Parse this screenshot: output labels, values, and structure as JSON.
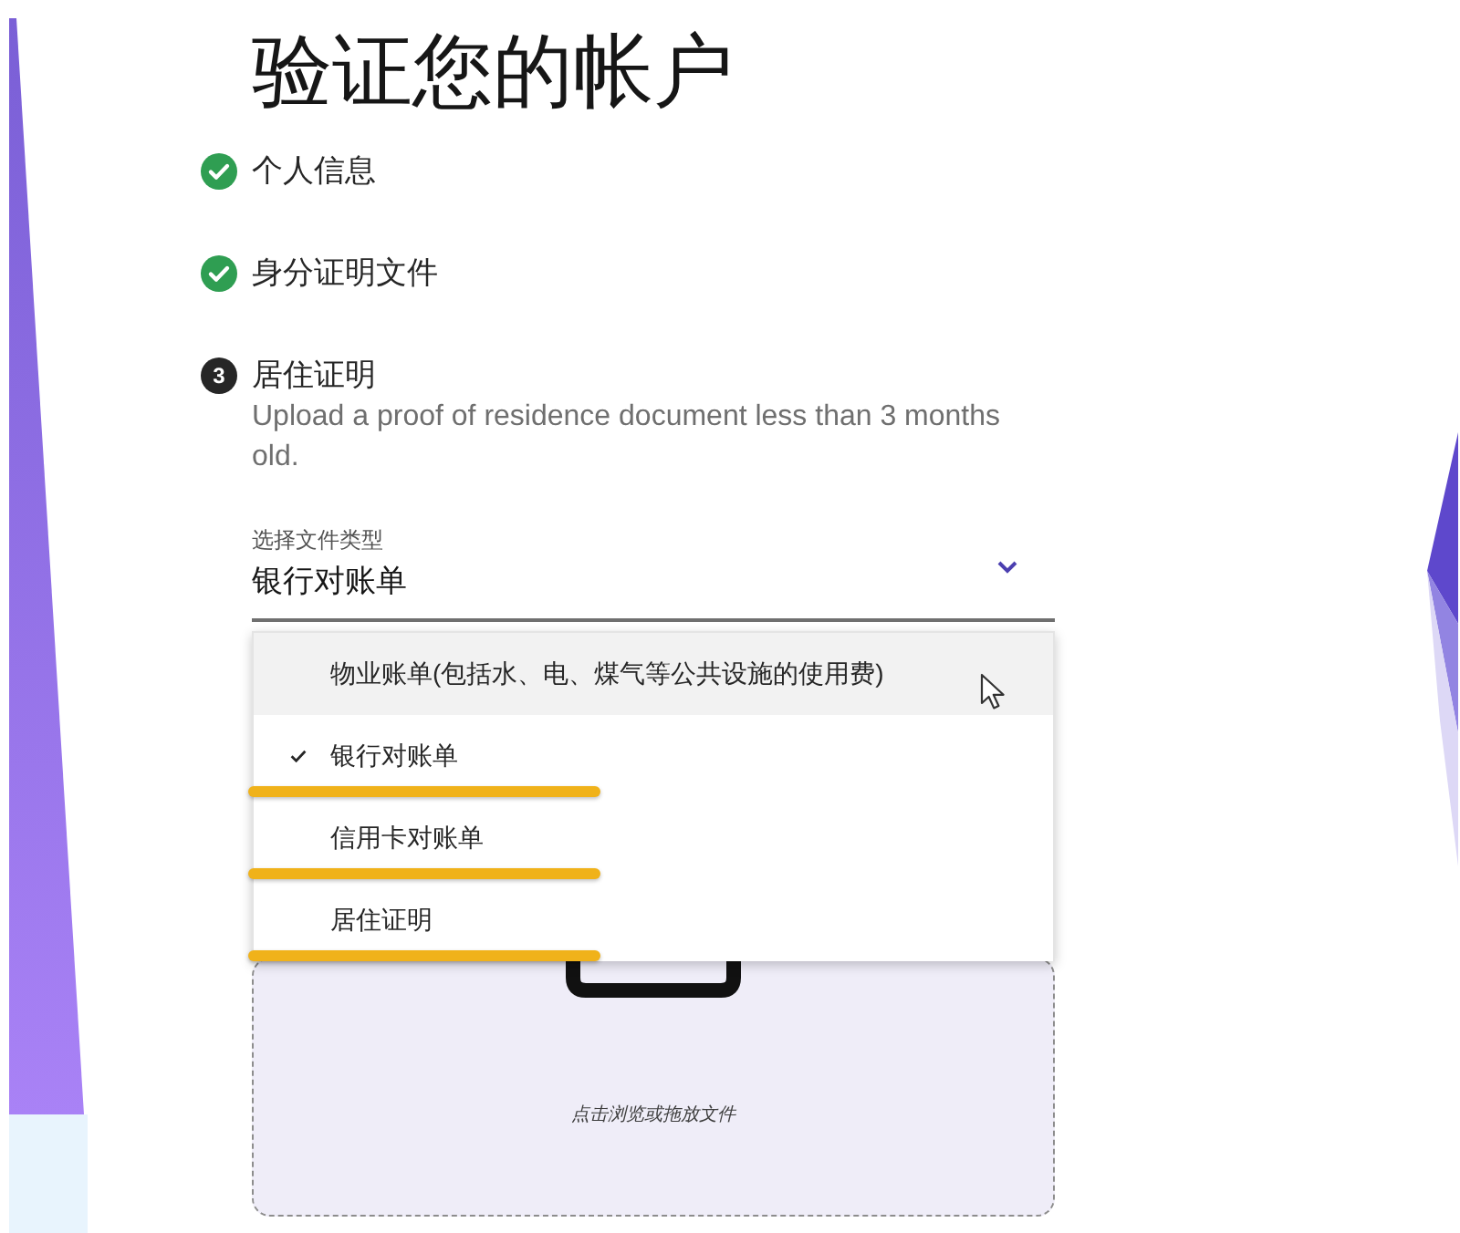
{
  "title": "验证您的帐户",
  "steps": [
    {
      "label": "个人信息",
      "kind": "done"
    },
    {
      "label": "身分证明文件",
      "kind": "done"
    },
    {
      "label": "居住证明",
      "kind": "current",
      "number": "3",
      "description": "Upload a proof of residence document less than 3 months old."
    }
  ],
  "document_type_select": {
    "label": "选择文件类型",
    "value": "银行对账单",
    "expanded": true,
    "options": [
      {
        "label": "物业账单(包括水、电、煤气等公共设施的使用费)",
        "selected": false,
        "hovered": true,
        "annotated": false
      },
      {
        "label": "银行对账单",
        "selected": true,
        "hovered": false,
        "annotated": true
      },
      {
        "label": "信用卡对账单",
        "selected": false,
        "hovered": false,
        "annotated": true
      },
      {
        "label": "居住证明",
        "selected": false,
        "hovered": false,
        "annotated": true
      }
    ]
  },
  "upload_area": {
    "prompt": "点击浏览或拖放文件"
  }
}
